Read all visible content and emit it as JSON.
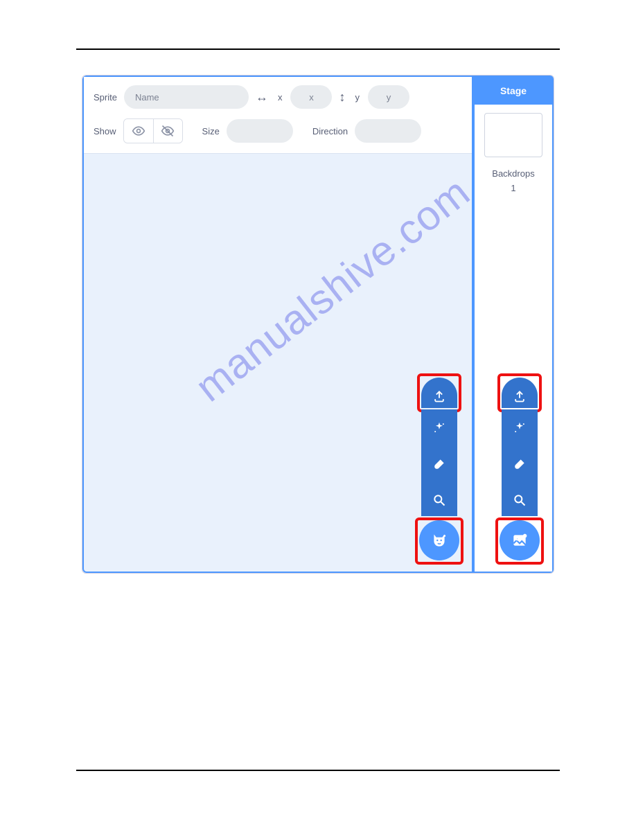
{
  "sprite_panel": {
    "sprite_label": "Sprite",
    "name_placeholder": "Name",
    "x_label": "x",
    "x_placeholder": "x",
    "y_label": "y",
    "y_placeholder": "y",
    "show_label": "Show",
    "size_label": "Size",
    "size_value": "",
    "direction_label": "Direction",
    "direction_value": ""
  },
  "stage_panel": {
    "title": "Stage",
    "backdrops_label": "Backdrops",
    "backdrops_count": "1"
  },
  "sprite_menu": {
    "upload_icon": "upload-icon",
    "surprise_icon": "sparkle-icon",
    "paint_icon": "paintbrush-icon",
    "search_icon": "search-icon",
    "main_icon": "cat-icon"
  },
  "backdrop_menu": {
    "upload_icon": "upload-icon",
    "surprise_icon": "sparkle-icon",
    "paint_icon": "paintbrush-icon",
    "search_icon": "search-icon",
    "main_icon": "image-icon"
  },
  "watermark": "manualshive.com"
}
